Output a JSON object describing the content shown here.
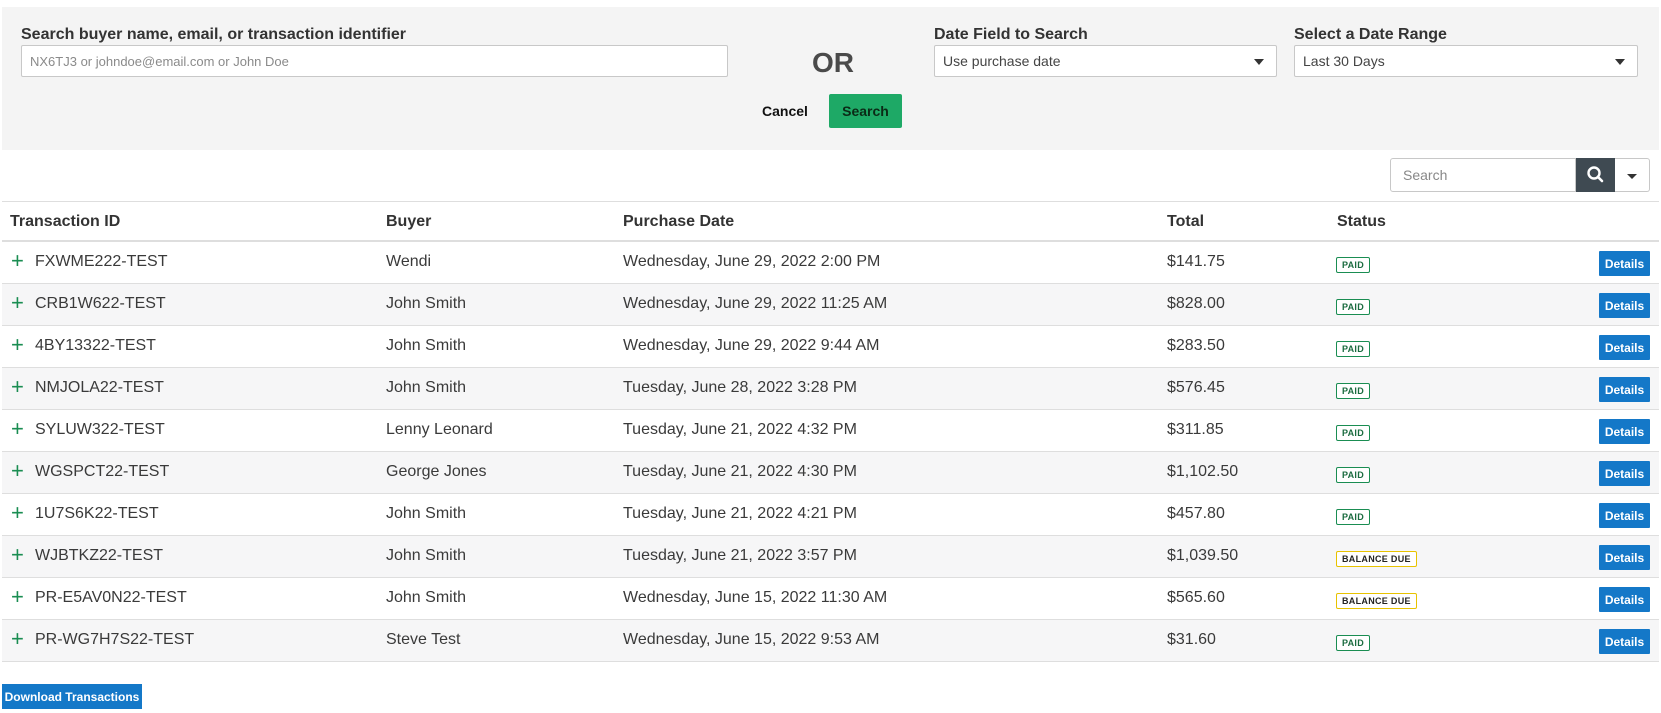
{
  "search_panel": {
    "buyer_label": "Search buyer name, email, or transaction identifier",
    "buyer_placeholder": "NX6TJ3 or johndoe@email.com or John Doe",
    "buyer_value": "",
    "or_text": "OR",
    "date_field_label": "Date Field to Search",
    "date_field_value": "Use purchase date",
    "date_range_label": "Select a Date Range",
    "date_range_value": "Last 30 Days",
    "cancel_label": "Cancel",
    "search_label": "Search"
  },
  "toolbar": {
    "search_placeholder": "Search",
    "search_icon": "search-icon",
    "dropdown_icon": "caret-down-icon"
  },
  "table": {
    "columns": {
      "transaction_id": "Transaction ID",
      "buyer": "Buyer",
      "purchase_date": "Purchase Date",
      "total": "Total",
      "status": "Status"
    },
    "expand_glyph": "+",
    "details_label": "Details",
    "rows": [
      {
        "id": "FXWME222-TEST",
        "buyer": "Wendi",
        "date": "Wednesday, June 29, 2022 2:00 PM",
        "total": "$141.75",
        "status": "PAID",
        "status_type": "paid"
      },
      {
        "id": "CRB1W622-TEST",
        "buyer": "John Smith",
        "date": "Wednesday, June 29, 2022 11:25 AM",
        "total": "$828.00",
        "status": "PAID",
        "status_type": "paid"
      },
      {
        "id": "4BY13322-TEST",
        "buyer": "John Smith",
        "date": "Wednesday, June 29, 2022 9:44 AM",
        "total": "$283.50",
        "status": "PAID",
        "status_type": "paid"
      },
      {
        "id": "NMJOLA22-TEST",
        "buyer": "John Smith",
        "date": "Tuesday, June 28, 2022 3:28 PM",
        "total": "$576.45",
        "status": "PAID",
        "status_type": "paid"
      },
      {
        "id": "SYLUW322-TEST",
        "buyer": "Lenny Leonard",
        "date": "Tuesday, June 21, 2022 4:32 PM",
        "total": "$311.85",
        "status": "PAID",
        "status_type": "paid"
      },
      {
        "id": "WGSPCT22-TEST",
        "buyer": "George Jones",
        "date": "Tuesday, June 21, 2022 4:30 PM",
        "total": "$1,102.50",
        "status": "PAID",
        "status_type": "paid"
      },
      {
        "id": "1U7S6K22-TEST",
        "buyer": "John Smith",
        "date": "Tuesday, June 21, 2022 4:21 PM",
        "total": "$457.80",
        "status": "PAID",
        "status_type": "paid"
      },
      {
        "id": "WJBTKZ22-TEST",
        "buyer": "John Smith",
        "date": "Tuesday, June 21, 2022 3:57 PM",
        "total": "$1,039.50",
        "status": "BALANCE DUE",
        "status_type": "due"
      },
      {
        "id": "PR-E5AV0N22-TEST",
        "buyer": "John Smith",
        "date": "Wednesday, June 15, 2022 11:30 AM",
        "total": "$565.60",
        "status": "BALANCE DUE",
        "status_type": "due"
      },
      {
        "id": "PR-WG7H7S22-TEST",
        "buyer": "Steve Test",
        "date": "Wednesday, June 15, 2022 9:53 AM",
        "total": "$31.60",
        "status": "PAID",
        "status_type": "paid"
      }
    ]
  },
  "footer": {
    "download_label": "Download Transactions"
  },
  "colors": {
    "accent_green": "#1ea966",
    "details_blue": "#1478c8",
    "paid_border": "#1a8d52",
    "due_border": "#e8c300"
  }
}
